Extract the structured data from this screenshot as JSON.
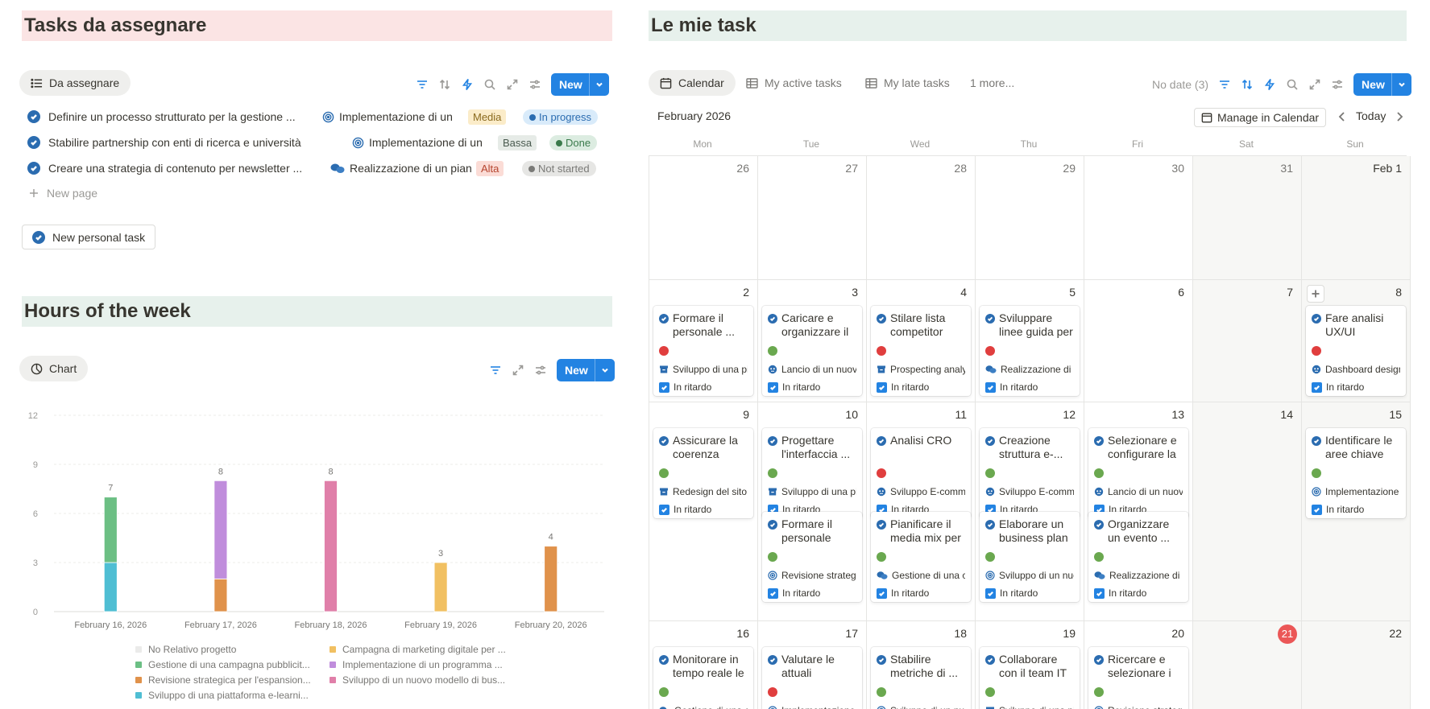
{
  "left": {
    "title": "Tasks da assegnare",
    "view_label": "Da assegnare",
    "new_label": "New",
    "tasks": [
      {
        "name": "Definire un processo strutturato per la gestione ...",
        "project": "Implementazione di un",
        "project_icon": "target-icon",
        "priority": "Media",
        "status": "In progress"
      },
      {
        "name": "Stabilire partnership con enti di ricerca e università",
        "project": "Implementazione di un",
        "project_icon": "target-icon",
        "priority": "Bassa",
        "status": "Done"
      },
      {
        "name": "Creare una strategia di contenuto per newsletter ...",
        "project": "Realizzazione di un pian",
        "project_icon": "chat-bubbles-icon",
        "priority": "Alta",
        "status": "Not started"
      }
    ],
    "new_page_label": "New page",
    "personal_task_label": "New personal task"
  },
  "hours": {
    "title": "Hours of the week",
    "view_label": "Chart",
    "new_label": "New"
  },
  "colors": {
    "no_project": "#ebebea",
    "gestione": "#6cbf84",
    "revisione": "#e0924b",
    "sviluppo_elearning": "#4fbed3",
    "campagna": "#f1c062",
    "implementazione": "#c08ddc",
    "sviluppo_modello": "#e07fa9"
  },
  "chart_data": {
    "type": "bar",
    "stacked": true,
    "categories": [
      "February 16, 2026",
      "February 17, 2026",
      "February 18, 2026",
      "February 19, 2026",
      "February 20, 2026"
    ],
    "ylim": [
      0,
      12
    ],
    "yticks": [
      0,
      3,
      6,
      9,
      12
    ],
    "totals": [
      7,
      8,
      8,
      3,
      4
    ],
    "series": [
      {
        "name": "No Relativo progetto",
        "color": "#ebebea",
        "values": [
          0,
          0,
          0,
          0,
          0
        ]
      },
      {
        "name": "Gestione di una campagna pubblicit...",
        "color": "#6cbf84",
        "values": [
          4,
          0,
          0,
          0,
          0
        ]
      },
      {
        "name": "Revisione strategica per l'espansion...",
        "color": "#e0924b",
        "values": [
          0,
          2,
          0,
          0,
          4
        ]
      },
      {
        "name": "Sviluppo di una piattaforma e-learni...",
        "color": "#4fbed3",
        "values": [
          3,
          0,
          0,
          0,
          0
        ]
      },
      {
        "name": "Campagna di marketing digitale per ...",
        "color": "#f1c062",
        "values": [
          0,
          0,
          0,
          3,
          0
        ]
      },
      {
        "name": "Implementazione di un programma ...",
        "color": "#c08ddc",
        "values": [
          0,
          6,
          0,
          0,
          0
        ]
      },
      {
        "name": "Sviluppo di un nuovo modello di bus...",
        "color": "#e07fa9",
        "values": [
          0,
          0,
          8,
          0,
          0
        ]
      }
    ],
    "legend_position": "bottom",
    "grid": true
  },
  "right": {
    "title": "Le mie task",
    "tabs": [
      "Calendar",
      "My active tasks",
      "My late tasks",
      "1 more..."
    ],
    "no_date": "No date (3)",
    "new_label": "New",
    "month": "February 2026",
    "manage_label": "Manage in Calendar",
    "today_label": "Today",
    "weekdays": [
      "Mon",
      "Tue",
      "Wed",
      "Thu",
      "Fri",
      "Sat",
      "Sun"
    ],
    "late_label": "In ritardo",
    "weeks": [
      {
        "days": [
          "26",
          "27",
          "28",
          "29",
          "30",
          "31",
          "Feb 1"
        ]
      },
      {
        "days": [
          "2",
          "3",
          "4",
          "5",
          "6",
          "7",
          "8"
        ]
      },
      {
        "days": [
          "9",
          "10",
          "11",
          "12",
          "13",
          "14",
          "15"
        ]
      },
      {
        "days": [
          "16",
          "17",
          "18",
          "19",
          "20",
          "21",
          "22"
        ]
      }
    ],
    "cards": [
      {
        "week": 1,
        "day": 0,
        "slot": 0,
        "title": "Formare il personale ...",
        "dot": "#e03e3e",
        "project": "Sviluppo di una piattaforma",
        "icon": "archive"
      },
      {
        "week": 1,
        "day": 1,
        "slot": 0,
        "title": "Caricare e organizzare il ...",
        "dot": "#6aa84f",
        "project": "Lancio di un nuovo",
        "icon": "face"
      },
      {
        "week": 1,
        "day": 2,
        "slot": 0,
        "title": "Stilare lista competitor",
        "dot": "#e03e3e",
        "project": "Prospecting analysis",
        "icon": "archive"
      },
      {
        "week": 1,
        "day": 3,
        "slot": 0,
        "title": "Sviluppare linee guida per ...",
        "dot": "#e03e3e",
        "project": "Realizzazione di un",
        "icon": "chat"
      },
      {
        "week": 1,
        "day": 6,
        "slot": 0,
        "title": "Fare analisi UX/UI",
        "dot": "#e03e3e",
        "project": "Dashboard design",
        "icon": "face"
      },
      {
        "week": 2,
        "day": 0,
        "slot": 0,
        "title": "Assicurare la coerenza visiva...",
        "dot": "#6aa84f",
        "project": "Redesign del sito web",
        "icon": "archive"
      },
      {
        "week": 2,
        "day": 1,
        "slot": 0,
        "title": "Progettare l'interfaccia ...",
        "dot": "#6aa84f",
        "project": "Sviluppo di una piattaforma",
        "icon": "archive"
      },
      {
        "week": 2,
        "day": 2,
        "slot": 0,
        "title": "Analisi CRO",
        "dot": "#e03e3e",
        "project": "Sviluppo E-commerce",
        "icon": "face"
      },
      {
        "week": 2,
        "day": 3,
        "slot": 0,
        "title": "Creazione struttura e-...",
        "dot": "#6aa84f",
        "project": "Sviluppo E-commerce",
        "icon": "face"
      },
      {
        "week": 2,
        "day": 4,
        "slot": 0,
        "title": "Selezionare e configurare la ...",
        "dot": "#6aa84f",
        "project": "Lancio di un nuovo",
        "icon": "face"
      },
      {
        "week": 2,
        "day": 6,
        "slot": 0,
        "title": "Identificare le aree chiave per...",
        "dot": "#6aa84f",
        "project": "Implementazione",
        "icon": "target"
      },
      {
        "week": 2,
        "day": 1,
        "slot": 1,
        "title": "Formare il personale sulle ...",
        "dot": "#6aa84f",
        "project": "Revisione strategica",
        "icon": "target"
      },
      {
        "week": 2,
        "day": 2,
        "slot": 1,
        "title": "Pianificare il media mix per ...",
        "dot": "#6aa84f",
        "project": "Gestione di una campagna",
        "icon": "chat"
      },
      {
        "week": 2,
        "day": 3,
        "slot": 1,
        "title": "Elaborare un business plan ...",
        "dot": "#6aa84f",
        "project": "Sviluppo di un nuovo",
        "icon": "target"
      },
      {
        "week": 2,
        "day": 4,
        "slot": 1,
        "title": "Organizzare un evento ...",
        "dot": "#6aa84f",
        "project": "Realizzazione di un",
        "icon": "chat"
      },
      {
        "week": 3,
        "day": 0,
        "slot": 0,
        "title": "Monitorare in tempo reale le ...",
        "dot": "#6aa84f",
        "project": "Gestione di una campagna",
        "icon": "chat"
      },
      {
        "week": 3,
        "day": 1,
        "slot": 0,
        "title": "Valutare le attuali capacità...",
        "dot": "#e03e3e",
        "project": "Implementazione",
        "icon": "target"
      },
      {
        "week": 3,
        "day": 2,
        "slot": 0,
        "title": "Stabilire metriche di ...",
        "dot": "#6aa84f",
        "project": "Sviluppo di un nuovo",
        "icon": "target"
      },
      {
        "week": 3,
        "day": 3,
        "slot": 0,
        "title": "Collaborare con il team IT p...",
        "dot": "#6aa84f",
        "project": "Sviluppo di una piattaforma",
        "icon": "archive"
      },
      {
        "week": 3,
        "day": 4,
        "slot": 0,
        "title": "Ricercare e selezionare i ...",
        "dot": "#6aa84f",
        "project": "Revisione strategica",
        "icon": "target"
      }
    ]
  }
}
